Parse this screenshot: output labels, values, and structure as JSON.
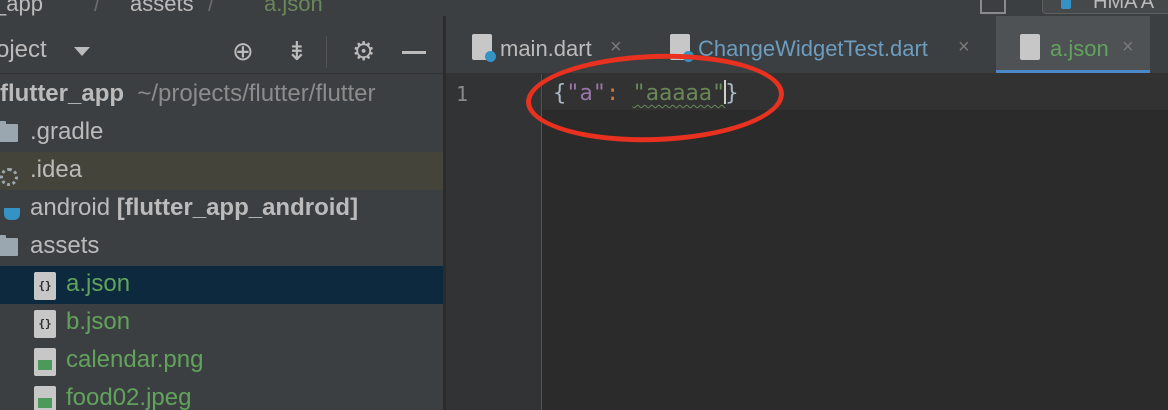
{
  "navbar": {
    "crumb_project": "_app",
    "crumb_sep1": "/",
    "crumb_folder": "assets",
    "crumb_sep2": "/",
    "crumb_file": "a.json",
    "device_label": "HMA A"
  },
  "project_panel": {
    "title": "oject",
    "tree": [
      {
        "label": "flutter_app",
        "path": "~/projects/flutter/flutter"
      },
      {
        "label": ".gradle"
      },
      {
        "label": ".idea"
      },
      {
        "label": "android",
        "module": "[flutter_app_android]"
      },
      {
        "label": "assets"
      },
      {
        "label": "a.json"
      },
      {
        "label": "b.json"
      },
      {
        "label": "calendar.png"
      },
      {
        "label": "food02.jpeg"
      }
    ]
  },
  "tabs": [
    {
      "label": "main.dart",
      "close": "×"
    },
    {
      "label": "ChangeWidgetTest.dart",
      "close": "×"
    },
    {
      "label": "a.json",
      "close": "×"
    }
  ],
  "editor": {
    "line_number": "1",
    "open_brace": "{",
    "key": "\"a\"",
    "colon": ":",
    "value": "\"aaaaa\"",
    "close_brace": "}"
  },
  "colors": {
    "annotation": "#e8311f",
    "selection": "#0d293e",
    "active_tab_underline": "#4a88c7",
    "json_key": "#9876aa",
    "json_string": "#6a8759"
  }
}
